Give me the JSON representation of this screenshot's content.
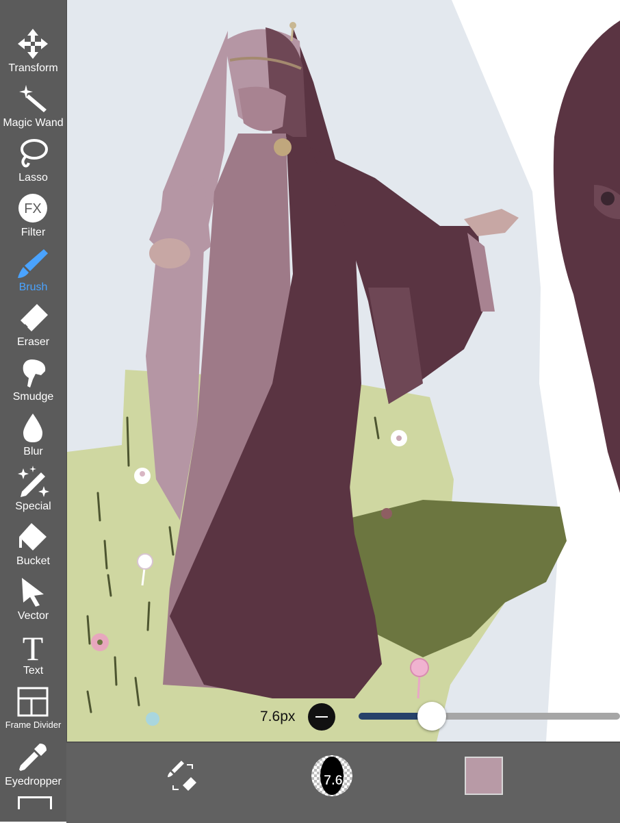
{
  "toolbar": {
    "tools": [
      {
        "label": "Transform",
        "icon": "transform-icon"
      },
      {
        "label": "Magic Wand",
        "icon": "magic-wand-icon"
      },
      {
        "label": "Lasso",
        "icon": "lasso-icon"
      },
      {
        "label": "Filter",
        "icon": "filter-icon",
        "icon_text": "FX"
      },
      {
        "label": "Brush",
        "icon": "brush-icon",
        "active": true
      },
      {
        "label": "Eraser",
        "icon": "eraser-icon"
      },
      {
        "label": "Smudge",
        "icon": "smudge-icon"
      },
      {
        "label": "Blur",
        "icon": "blur-icon"
      },
      {
        "label": "Special",
        "icon": "special-icon"
      },
      {
        "label": "Bucket",
        "icon": "bucket-icon"
      },
      {
        "label": "Vector",
        "icon": "vector-icon"
      },
      {
        "label": "Text",
        "icon": "text-icon",
        "icon_text": "T"
      },
      {
        "label": "Frame Divider",
        "icon": "frame-divider-icon"
      },
      {
        "label": "Eyedropper",
        "icon": "eyedropper-icon"
      }
    ]
  },
  "brush_size": {
    "label": "7.6px",
    "value": 7.6,
    "slider_fraction": 0.28
  },
  "bottom_bar": {
    "brush_preview_text": "7.6",
    "color_swatch": "#b89aa6"
  },
  "colors": {
    "toolbar_bg": "#5b5b5b",
    "active_tool": "#4aa3ff",
    "slider_fill": "#27426a",
    "sky": "#e3e8ee",
    "grass_light": "#cfd7a1",
    "grass_dark": "#6c7640",
    "dress_light": "#9e7a88",
    "dress_dark": "#5a3442",
    "hair": "#b596a4"
  }
}
